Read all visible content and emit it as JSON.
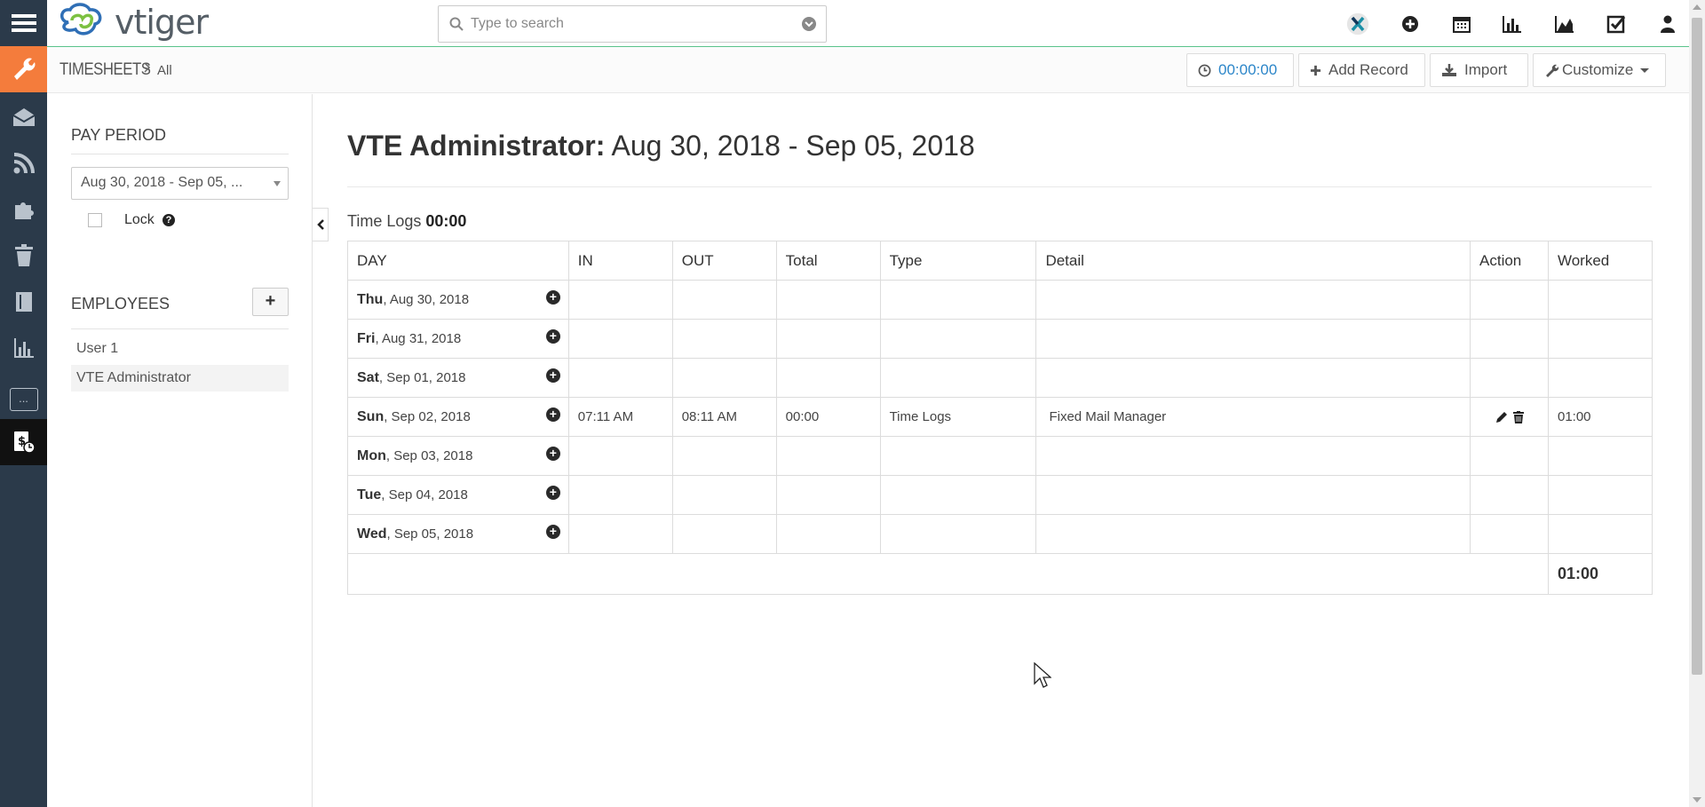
{
  "app": {
    "brand": "vtiger"
  },
  "rail": {
    "items": [
      {
        "name": "menu-icon"
      },
      {
        "name": "wrench-icon"
      },
      {
        "name": "mail-icon"
      },
      {
        "name": "rss-icon"
      },
      {
        "name": "puzzle-icon"
      },
      {
        "name": "trash-icon"
      },
      {
        "name": "book-icon"
      },
      {
        "name": "bar-chart-icon"
      },
      {
        "name": "more-icon",
        "label": "..."
      },
      {
        "name": "timesheet-icon"
      }
    ]
  },
  "search": {
    "placeholder": "Type to search"
  },
  "header": {
    "module": "TIMESHEETS",
    "separator": ">",
    "view": "All",
    "timer": "00:00:00",
    "add_record": "Add Record",
    "import": "Import",
    "customize": "Customize"
  },
  "left": {
    "pay_period_title": "PAY PERIOD",
    "pay_period_value": "Aug 30, 2018 - Sep 05, ...",
    "lock_label": "Lock",
    "lock_help": "?",
    "employees_title": "EMPLOYEES",
    "add_employee": "+",
    "employees": [
      "User 1",
      "VTE Administrator"
    ]
  },
  "main": {
    "title_name": "VTE Administrator:",
    "title_range": "Aug 30, 2018 - Sep 05, 2018",
    "timelogs_label": "Time Logs",
    "timelogs_value": "00:00",
    "columns": [
      "DAY",
      "IN",
      "OUT",
      "Total",
      "Type",
      "Detail",
      "Action",
      "Worked"
    ],
    "rows": [
      {
        "day": "Thu",
        "date": ", Aug 30, 2018",
        "in": "",
        "out": "",
        "total": "",
        "type": "",
        "detail": "",
        "worked": ""
      },
      {
        "day": "Fri",
        "date": ", Aug 31, 2018",
        "in": "",
        "out": "",
        "total": "",
        "type": "",
        "detail": "",
        "worked": ""
      },
      {
        "day": "Sat",
        "date": ", Sep 01, 2018",
        "in": "",
        "out": "",
        "total": "",
        "type": "",
        "detail": "",
        "worked": ""
      },
      {
        "day": "Sun",
        "date": ", Sep 02, 2018",
        "in": "07:11 AM",
        "out": "08:11 AM",
        "total": "00:00",
        "type": "Time Logs",
        "detail": "Fixed Mail Manager",
        "worked": "01:00",
        "actions": true
      },
      {
        "day": "Mon",
        "date": ", Sep 03, 2018",
        "in": "",
        "out": "",
        "total": "",
        "type": "",
        "detail": "",
        "worked": ""
      },
      {
        "day": "Tue",
        "date": ", Sep 04, 2018",
        "in": "",
        "out": "",
        "total": "",
        "type": "",
        "detail": "",
        "worked": ""
      },
      {
        "day": "Wed",
        "date": ", Sep 05, 2018",
        "in": "",
        "out": "",
        "total": "",
        "type": "",
        "detail": "",
        "worked": ""
      }
    ],
    "grand_total": "01:00"
  },
  "colors": {
    "rail_bg": "#2b3a4a",
    "rail_active": "#f47c3c",
    "accent_blue": "#2c86c9",
    "header_line": "#59c28a"
  }
}
